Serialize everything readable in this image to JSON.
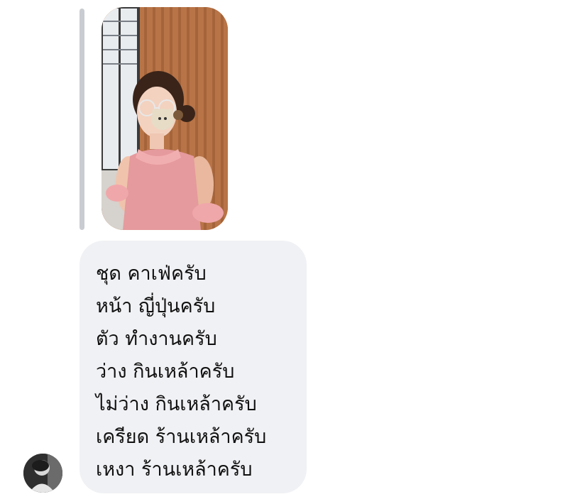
{
  "conversation": {
    "photo_attachment": {
      "description_icon": "photo-attachment"
    },
    "message": {
      "lines": [
        "ชุด คาเฟ่ครับ",
        "หน้า ญี่ปุ่นครับ",
        "ตัว ทำงานครับ",
        "ว่าง กินเหล้าครับ",
        "ไม่ว่าง กินเหล้าครับ",
        "เครียด ร้านเหล้าครับ",
        "เหงา ร้านเหล้าครับ"
      ]
    }
  },
  "colors": {
    "bubble_background": "#f0f1f4",
    "reply_bar": "#c9ccd1",
    "text": "#101010"
  }
}
